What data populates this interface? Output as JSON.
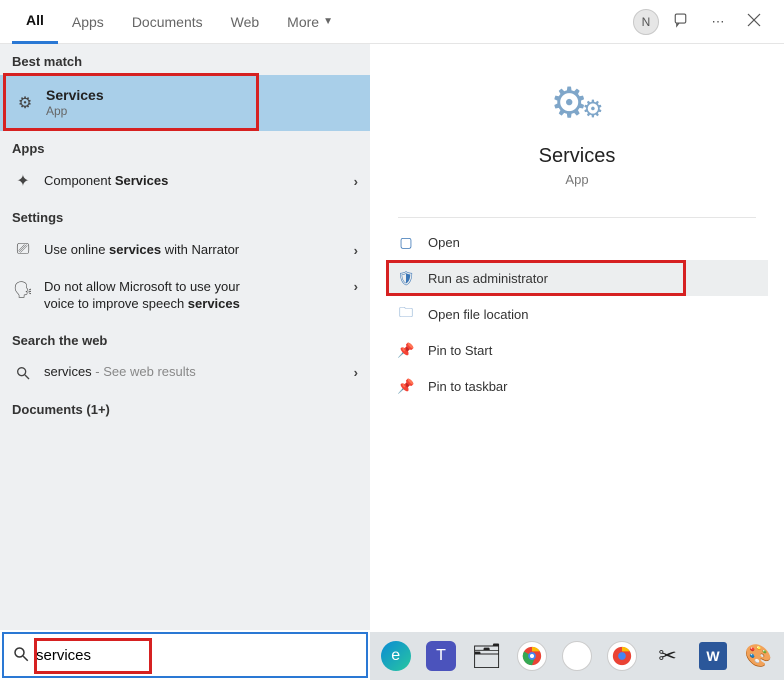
{
  "tabs": {
    "all": "All",
    "apps": "Apps",
    "documents": "Documents",
    "web": "Web",
    "more": "More"
  },
  "avatar_initial": "N",
  "left": {
    "best_match_header": "Best match",
    "best_match": {
      "title": "Services",
      "sub": "App"
    },
    "apps_header": "Apps",
    "component_services_pre": "Component ",
    "component_services_bold": "Services",
    "settings_header": "Settings",
    "narrator_pre": "Use online ",
    "narrator_bold": "services",
    "narrator_post": " with Narrator",
    "speech_line1": "Do not allow Microsoft to use your",
    "speech_line2_pre": "voice to improve speech ",
    "speech_line2_bold": "services",
    "search_web_header": "Search the web",
    "web_result_term": "services",
    "web_result_suffix": " - See web results",
    "documents_header": "Documents (1+)"
  },
  "right": {
    "title": "Services",
    "sub": "App",
    "actions": {
      "open": "Open",
      "run_admin": "Run as administrator",
      "open_loc": "Open file location",
      "pin_start": "Pin to Start",
      "pin_taskbar": "Pin to taskbar"
    }
  },
  "search": {
    "value": "services"
  }
}
